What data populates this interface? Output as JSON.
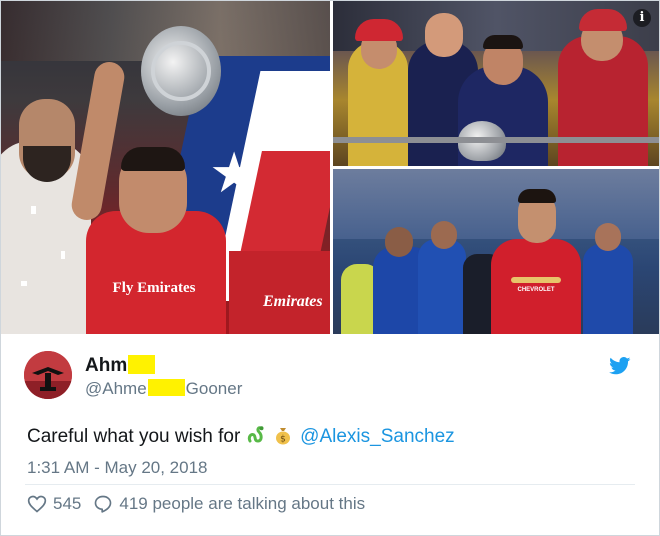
{
  "media": {
    "left_photo": {
      "jersey_sponsor": "Fly Emirates",
      "jersey_sponsor_secondary": "Emirates"
    },
    "bottom_right_photo": {
      "jersey_sponsor": "CHEVROLET"
    }
  },
  "tweet": {
    "author_name": "Ahm",
    "author_handle_start": "@Ahme",
    "author_handle_end": "Gooner",
    "text_prefix": "Careful what you wish for",
    "mention": "@Alexis_Sanchez",
    "timestamp": "1:31 AM - May 20, 2018",
    "likes": "545",
    "talking": "419 people are talking about this"
  },
  "icons": {
    "info": "info-icon",
    "bird": "twitter-bird-icon",
    "heart": "heart-icon",
    "reply": "reply-bubble-icon",
    "snake": "snake-emoji-icon",
    "money": "money-bag-emoji-icon"
  },
  "colors": {
    "text": "#14171a",
    "secondary_text": "#657786",
    "link": "#1b95e0",
    "redaction": "#fff200",
    "twitter_blue": "#1da1f2"
  }
}
